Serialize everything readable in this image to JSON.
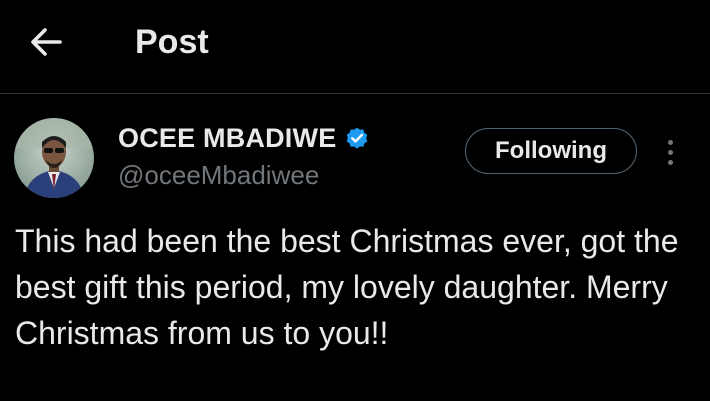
{
  "header": {
    "title": "Post",
    "back_icon": "arrow-left-icon"
  },
  "author": {
    "display_name": "OCEE MBADIWE",
    "handle": "@oceeMbadiwee",
    "verified": true,
    "verified_icon": "verified-badge-icon",
    "verified_color": "#1d9bf0"
  },
  "actions": {
    "follow_label": "Following",
    "more_icon": "more-vertical-icon"
  },
  "post": {
    "text": "This had been the best Christmas ever, got the best gift this period, my lovely daughter. Merry Christmas from us to you!!"
  },
  "colors": {
    "background": "#000000",
    "text_primary": "#e7e9ea",
    "text_secondary": "#71767b",
    "divider": "#2f3336"
  }
}
